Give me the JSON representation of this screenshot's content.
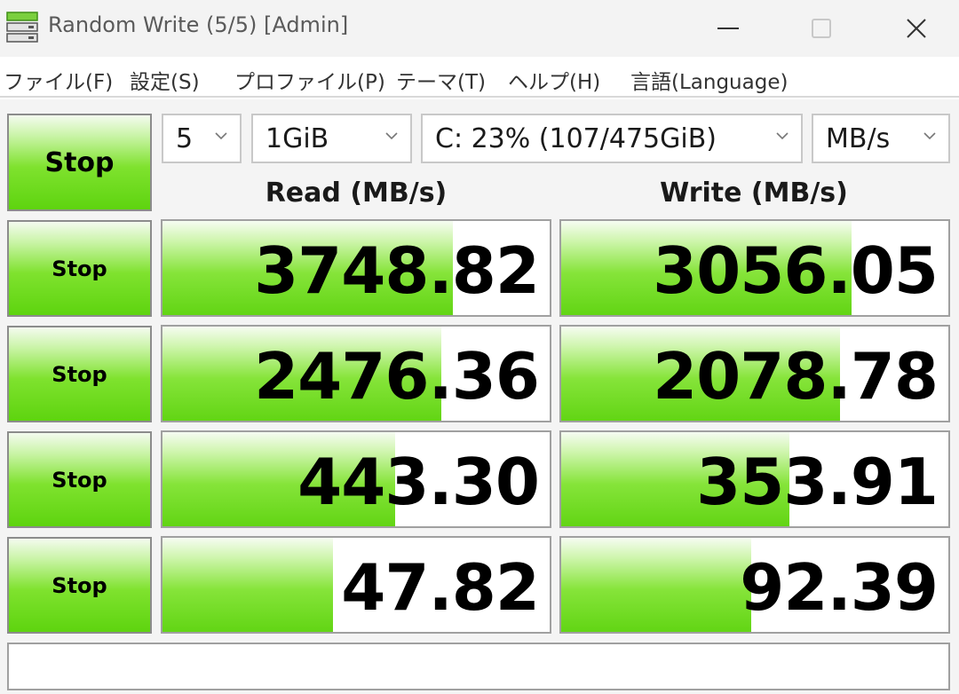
{
  "window": {
    "title": "Random Write (5/5) [Admin]",
    "close_glyph": "✕"
  },
  "menu": [
    "ファイル(F)",
    "設定(S)",
    "プロファイル(P)",
    "テーマ(T)",
    "ヘルプ(H)",
    "言語(Language)"
  ],
  "controls": {
    "main_button": "Stop",
    "count": "5",
    "size": "1GiB",
    "drive": "C: 23% (107/475GiB)",
    "unit": "MB/s"
  },
  "headers": {
    "read": "Read (MB/s)",
    "write": "Write (MB/s)"
  },
  "rows": [
    {
      "button": "Stop",
      "read": "3748.82",
      "write": "3056.05",
      "read_fill": 0.75,
      "write_fill": 0.75
    },
    {
      "button": "Stop",
      "read": "2476.36",
      "write": "2078.78",
      "read_fill": 0.72,
      "write_fill": 0.72
    },
    {
      "button": "Stop",
      "read": "443.30",
      "write": "353.91",
      "read_fill": 0.6,
      "write_fill": 0.59
    },
    {
      "button": "Stop",
      "read": "47.82",
      "write": "92.39",
      "read_fill": 0.44,
      "write_fill": 0.49
    }
  ],
  "colors": {
    "bar_green": "#62d514",
    "border": "#a0a0a0"
  },
  "icons": {
    "app": "drive-stack-icon",
    "chevron": "chevron-down-icon"
  }
}
